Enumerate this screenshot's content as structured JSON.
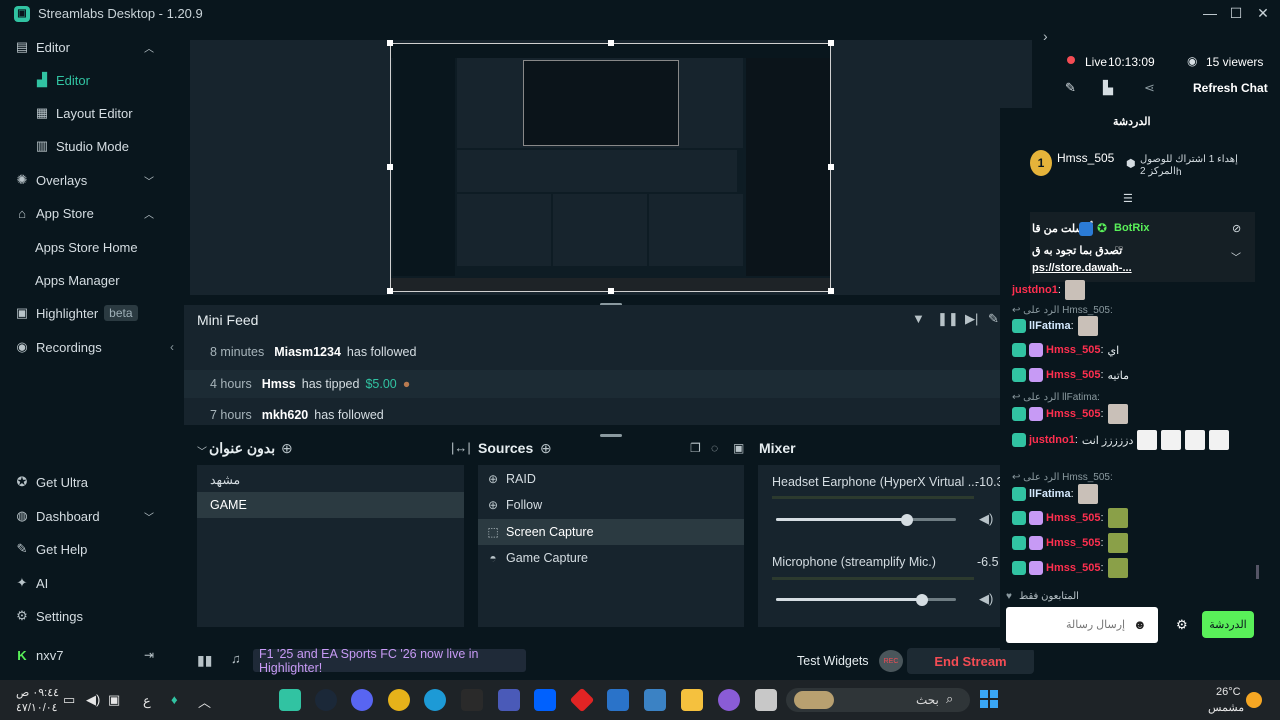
{
  "window": {
    "title": "Streamlabs Desktop - 1.20.9"
  },
  "sidebar": {
    "items": [
      {
        "label": "Editor",
        "icon": "editor-icon"
      },
      {
        "label": "Editor",
        "icon": "editor-icon"
      },
      {
        "label": "Layout Editor",
        "icon": "layout-icon"
      },
      {
        "label": "Studio Mode",
        "icon": "studio-icon"
      },
      {
        "label": "Overlays",
        "icon": "overlays-icon"
      },
      {
        "label": "App Store",
        "icon": "store-icon"
      },
      {
        "label": "Apps Store Home"
      },
      {
        "label": "Apps Manager"
      },
      {
        "label": "Highlighter",
        "badge": "beta"
      },
      {
        "label": "Recordings",
        "icon": "recordings-icon"
      }
    ],
    "bottom": [
      {
        "label": "Get Ultra"
      },
      {
        "label": "Dashboard"
      },
      {
        "label": "Get Help"
      },
      {
        "label": "AI"
      },
      {
        "label": "Settings"
      },
      {
        "label": "nxv7"
      }
    ]
  },
  "minifeed": {
    "title": "Mini Feed",
    "rows": [
      {
        "time": "8 minutes",
        "user": "Miasm1234",
        "action": "has followed",
        "amount": ""
      },
      {
        "time": "4 hours",
        "user": "Hmss",
        "action": "has tipped",
        "amount": "$5.00"
      },
      {
        "time": "7 hours",
        "user": "mkh620",
        "action": "has followed",
        "amount": ""
      }
    ]
  },
  "scenes": {
    "title": "بدون عنوان",
    "items": [
      "مشهد",
      "GAME"
    ]
  },
  "sources": {
    "title": "Sources",
    "items": [
      {
        "label": "RAID",
        "icon": "globe-icon"
      },
      {
        "label": "Follow",
        "icon": "globe-icon"
      },
      {
        "label": "Screen Capture",
        "icon": "screen-capture-icon"
      },
      {
        "label": "Game Capture",
        "icon": "gamepad-icon"
      }
    ]
  },
  "mixer": {
    "title": "Mixer",
    "channels": [
      {
        "name": "Headset Earphone (HyperX Virtual ...",
        "db": "-10.3",
        "level": 0.73
      },
      {
        "name": "Microphone (streamplify Mic.)",
        "db": "-6.5",
        "level": 0.81
      }
    ]
  },
  "footer": {
    "promo": "F1 '25 and EA Sports FC '26 now live in Highlighter!",
    "test_widgets": "Test Widgets",
    "rec": "REC",
    "end_stream": "End Stream"
  },
  "stream": {
    "live_label": "Live",
    "live_time": "10:13:09",
    "viewers": "15 viewers",
    "refresh_chat": "Refresh Chat"
  },
  "chat": {
    "header": "الدردشة",
    "pinned_user": "Hmss_505",
    "pinned_text": "إهداء 1 اشتراك للوصول",
    "pinned_sub": "المركز 2",
    "pinned_rank": "1",
    "pin_suffix": "h",
    "highlight_user": "BotRix",
    "highlight_line1": "أرسلت من قا",
    "highlight_line2": "تصدق بما تجود به ق",
    "highlight_link": "ps://store.dawah-...",
    "input_placeholder": "إرسال رسالة",
    "send_button": "الدردشة",
    "followers_only": "المتابعون فقط",
    "reply_prefix": "الرد على",
    "lines": [
      {
        "user": "justdno1",
        "text": ""
      },
      {
        "reply_to": "Hmss_505:",
        "user": "llFatima",
        "text": ""
      },
      {
        "user": "Hmss_505",
        "text": "اي"
      },
      {
        "user": "Hmss_505",
        "text": "ماتيه"
      },
      {
        "reply_to": "llFatima:",
        "user": "Hmss_505",
        "text": ""
      },
      {
        "user": "justdno1",
        "text": "دززززز انت"
      },
      {
        "reply_to": "Hmss_505:",
        "user": "llFatima",
        "text": ""
      },
      {
        "user": "Hmss_505",
        "text": ""
      },
      {
        "user": "Hmss_505",
        "text": ""
      },
      {
        "user": "Hmss_505",
        "text": ""
      }
    ]
  },
  "taskbar": {
    "search_placeholder": "بحث",
    "weather_temp": "26°C",
    "weather_desc": "مشمس",
    "clock_time": "٠٩:٤٤ ص",
    "clock_date": "٤٧/١٠/٠٤",
    "lang": "ع"
  },
  "colors": {
    "accent": "#31c3a2",
    "live": "#f44c54",
    "send": "#59f059"
  }
}
